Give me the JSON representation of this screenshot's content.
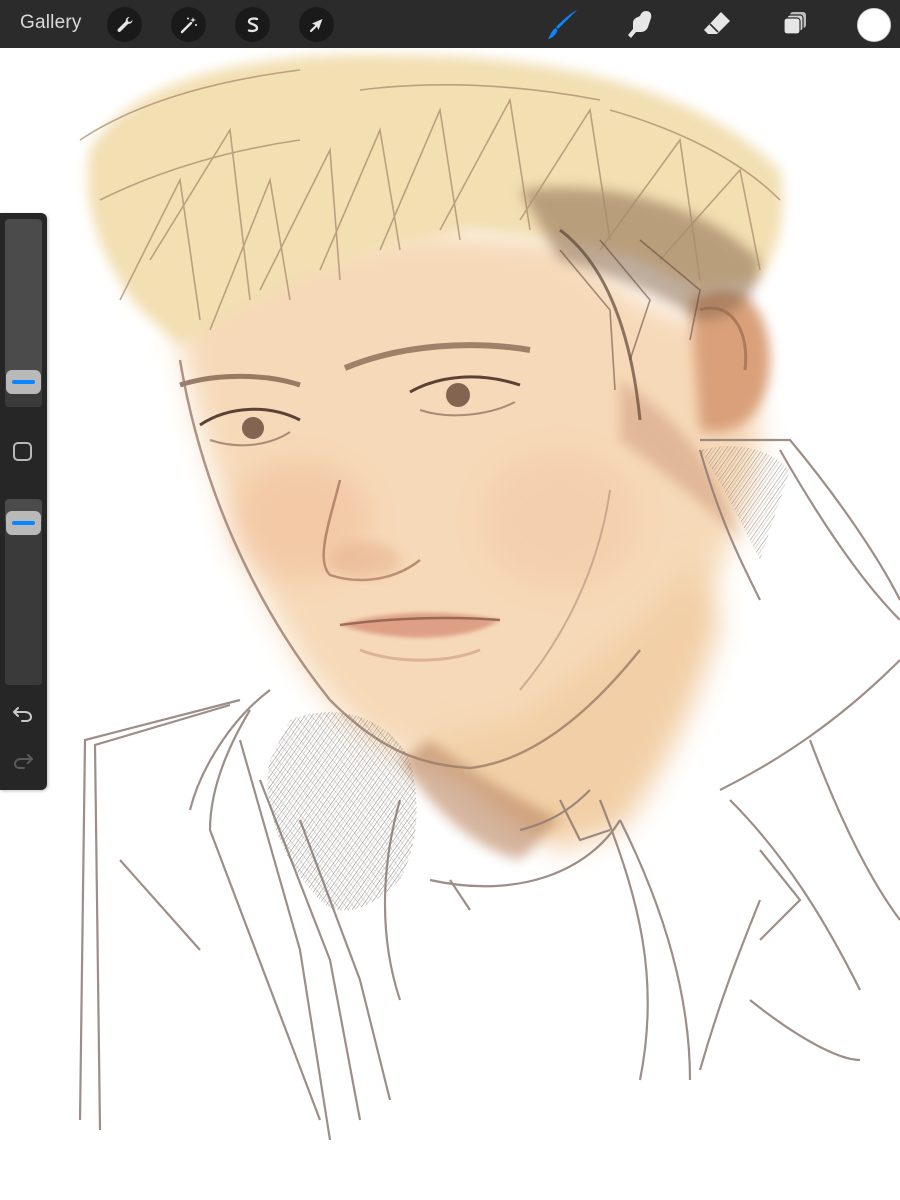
{
  "toolbar": {
    "gallery_label": "Gallery",
    "left_tools": [
      {
        "name": "actions",
        "icon": "wrench-icon"
      },
      {
        "name": "adjustments",
        "icon": "magic-wand-icon"
      },
      {
        "name": "selection",
        "icon": "selection-s-icon"
      },
      {
        "name": "transform",
        "icon": "arrow-cursor-icon"
      }
    ],
    "right_tools": [
      {
        "name": "brush",
        "icon": "brush-icon",
        "active": true
      },
      {
        "name": "smudge",
        "icon": "smudge-finger-icon",
        "active": false
      },
      {
        "name": "eraser",
        "icon": "eraser-icon",
        "active": false
      },
      {
        "name": "layers",
        "icon": "layers-icon",
        "active": false
      }
    ],
    "current_color": "#ffffff"
  },
  "sidebar": {
    "brush_size_level": 0.18,
    "opacity_level": 0.88,
    "modify_button_icon": "square-modify-icon",
    "undo_icon": "undo-arrow-icon",
    "redo_icon": "redo-arrow-icon",
    "redo_enabled": false
  },
  "canvas": {
    "artwork": "sketch-portrait",
    "colors": {
      "hair": "#efd9a6",
      "skin": "#f3cfab",
      "shadow": "#a86f48",
      "line": "#8a766b",
      "background": "#ffffff"
    }
  },
  "colors": {
    "toolbar_bg": "#2c2b2b",
    "sidebar_bg": "#262626",
    "accent": "#0a84ff",
    "icon_default": "#e6e6e6"
  }
}
